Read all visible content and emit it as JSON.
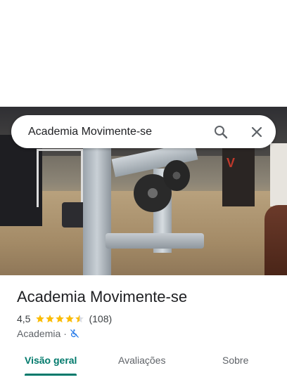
{
  "search": {
    "query": "Academia Movimente-se",
    "search_icon": "search-icon",
    "close_icon": "close-icon"
  },
  "photo": {
    "bag_text": "V"
  },
  "place": {
    "name": "Academia Movimente-se",
    "rating": "4,5",
    "rating_value": 4.5,
    "review_count": "(108)",
    "category": "Academia",
    "separator": "·",
    "accessibility_icon": "wheelchair-not-accessible-icon"
  },
  "tabs": [
    {
      "label": "Visão geral",
      "active": true
    },
    {
      "label": "Avaliações",
      "active": false
    },
    {
      "label": "Sobre",
      "active": false
    }
  ],
  "colors": {
    "accent": "#00796b",
    "star": "#fbbc04",
    "access_icon": "#1a73e8"
  }
}
